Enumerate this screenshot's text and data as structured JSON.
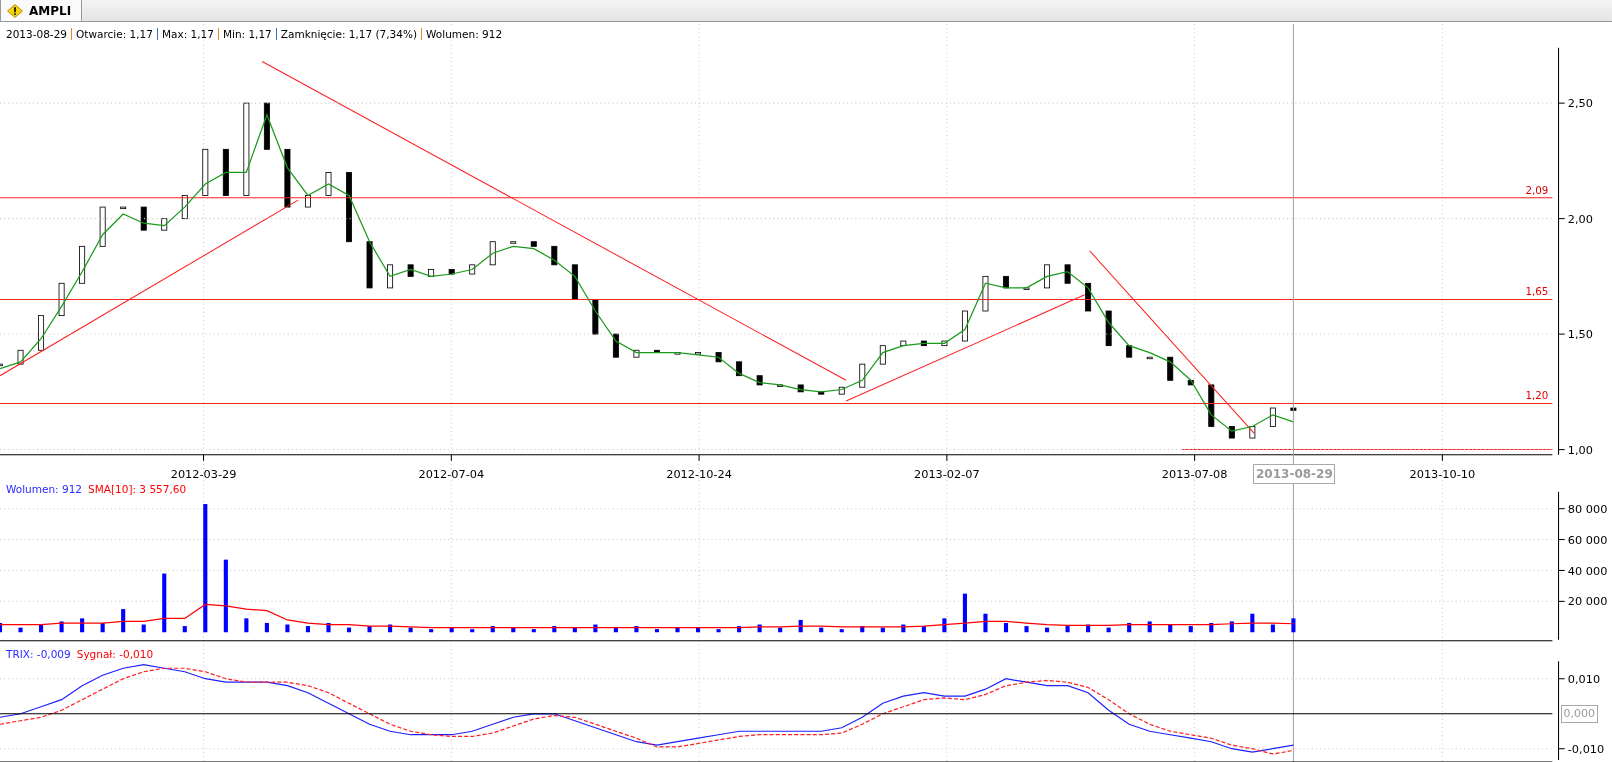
{
  "tab": {
    "label": "AMPLI",
    "selected": true
  },
  "info": [
    "2013-08-29",
    "Otwarcie: 1,17",
    "Max: 1,17",
    "Min: 1,17",
    "Zamknięcie: 1,17 (7,34%)",
    "Wolumen: 912"
  ],
  "price_panel": {
    "date_labels": [
      "2012-03-29",
      "2012-07-04",
      "2012-10-24",
      "2013-02-07",
      "2013-07-08",
      "2013-10-10"
    ],
    "cursor_label": "2013-08-29",
    "chart_data": {
      "type": "line",
      "ylim": [
        0.978,
        2.74
      ],
      "grid": true,
      "yticks": [
        {
          "value": 2.5,
          "label": "2,50"
        },
        {
          "value": 2.0,
          "label": "2,00"
        },
        {
          "value": 1.5,
          "label": "1,50"
        },
        {
          "value": 1.0,
          "label": "1,00"
        }
      ],
      "series": [
        {
          "color": "#1a9a1a",
          "values": [
            1.35,
            1.38,
            1.48,
            1.62,
            1.77,
            1.93,
            2.02,
            1.98,
            1.97,
            2.05,
            2.15,
            2.2,
            2.2,
            2.45,
            2.22,
            2.1,
            2.15,
            2.1,
            1.9,
            1.75,
            1.78,
            1.75,
            1.76,
            1.78,
            1.85,
            1.88,
            1.87,
            1.82,
            1.75,
            1.6,
            1.47,
            1.42,
            1.42,
            1.42,
            1.41,
            1.4,
            1.33,
            1.29,
            1.28,
            1.26,
            1.25,
            1.26,
            1.3,
            1.42,
            1.45,
            1.46,
            1.46,
            1.52,
            1.72,
            1.7,
            1.7,
            1.75,
            1.77,
            1.7,
            1.55,
            1.45,
            1.42,
            1.38,
            1.3,
            1.15,
            1.08,
            1.1,
            1.15,
            1.12
          ]
        }
      ],
      "ref_lines": [
        {
          "axis": "y",
          "value": 2.09,
          "label": "2,09"
        },
        {
          "axis": "y",
          "value": 1.65,
          "label": "1,65"
        },
        {
          "axis": "y",
          "value": 1.2,
          "label": "1,20"
        }
      ]
    }
  },
  "volume_panel": {
    "legend": [
      {
        "text": "Wolumen: 912",
        "color": "#2a2aff"
      },
      {
        "text": "SMA[10]: 3 557,60",
        "color": "#ff0000"
      }
    ],
    "chart_data": {
      "type": "bar",
      "ylim": [
        -4800,
        91000
      ],
      "grid": true,
      "yticks": [
        {
          "value": 80000,
          "label": "80 000"
        },
        {
          "value": 60000,
          "label": "60 000"
        },
        {
          "value": 40000,
          "label": "40 000"
        },
        {
          "value": 20000,
          "label": "20 000"
        }
      ],
      "series": [
        {
          "type": "bar",
          "color": "#0000ff",
          "values": [
            6000,
            3000,
            5000,
            7000,
            9000,
            6000,
            15000,
            5000,
            38000,
            4000,
            83000,
            47000,
            9000,
            6000,
            5000,
            4000,
            6000,
            3000,
            4000,
            5000,
            3000,
            2000,
            3000,
            2000,
            4000,
            3000,
            2000,
            4000,
            3000,
            5000,
            3000,
            4000,
            2000,
            3000,
            3000,
            2000,
            4000,
            5000,
            3000,
            8000,
            3000,
            2000,
            4000,
            3000,
            5000,
            4000,
            9000,
            25000,
            12000,
            6000,
            4000,
            3000,
            4000,
            5000,
            3000,
            6000,
            7000,
            5000,
            4000,
            6000,
            7000,
            12000,
            5000,
            9000
          ]
        },
        {
          "type": "line",
          "color": "#ff0000",
          "values": [
            5000,
            5000,
            5000,
            6000,
            6000,
            6000,
            7000,
            7000,
            9000,
            9000,
            18000,
            17000,
            15000,
            14000,
            8000,
            6000,
            5000,
            5000,
            4000,
            4000,
            3500,
            3000,
            3000,
            3000,
            3000,
            3000,
            3000,
            3000,
            3000,
            3000,
            3000,
            3000,
            3000,
            3000,
            3000,
            3000,
            3000,
            3500,
            3500,
            4000,
            4000,
            3500,
            3500,
            3500,
            3500,
            4000,
            5000,
            6000,
            7000,
            7000,
            6000,
            5000,
            4500,
            4500,
            4500,
            5000,
            5000,
            5000,
            5000,
            5000,
            5500,
            6000,
            6000,
            5500
          ]
        }
      ]
    }
  },
  "trix_panel": {
    "legend": [
      {
        "text": "TRIX: -0,009",
        "color": "#2a2aff"
      },
      {
        "text": "Sygnał: -0,010",
        "color": "#ff0000"
      }
    ],
    "zero_label": "0,000",
    "chart_data": {
      "type": "line",
      "ylim": [
        -0.0132,
        0.015
      ],
      "grid": true,
      "yticks": [
        {
          "value": 0.01,
          "label": "0,010"
        },
        {
          "value": -0.01,
          "label": "-0,010"
        }
      ],
      "series": [
        {
          "color": "#2020ff",
          "line_style": "solid",
          "values": [
            -0.001,
            0.0,
            0.002,
            0.004,
            0.008,
            0.011,
            0.013,
            0.014,
            0.013,
            0.012,
            0.01,
            0.009,
            0.009,
            0.009,
            0.008,
            0.006,
            0.003,
            0.0,
            -0.003,
            -0.005,
            -0.006,
            -0.006,
            -0.006,
            -0.005,
            -0.003,
            -0.001,
            0.0,
            0.0,
            -0.002,
            -0.004,
            -0.006,
            -0.008,
            -0.009,
            -0.008,
            -0.007,
            -0.006,
            -0.005,
            -0.005,
            -0.005,
            -0.005,
            -0.005,
            -0.004,
            -0.001,
            0.003,
            0.005,
            0.006,
            0.005,
            0.005,
            0.007,
            0.01,
            0.009,
            0.008,
            0.008,
            0.006,
            0.001,
            -0.003,
            -0.005,
            -0.006,
            -0.007,
            -0.008,
            -0.01,
            -0.011,
            -0.01,
            -0.009
          ]
        },
        {
          "color": "#ff2020",
          "line_style": "dashed",
          "values": [
            -0.003,
            -0.002,
            -0.001,
            0.001,
            0.004,
            0.007,
            0.01,
            0.012,
            0.013,
            0.013,
            0.012,
            0.01,
            0.009,
            0.009,
            0.009,
            0.008,
            0.006,
            0.003,
            0.0,
            -0.003,
            -0.005,
            -0.006,
            -0.0065,
            -0.0065,
            -0.0055,
            -0.0035,
            -0.0015,
            -0.0005,
            -0.001,
            -0.003,
            -0.005,
            -0.007,
            -0.0095,
            -0.0095,
            -0.0085,
            -0.0075,
            -0.0065,
            -0.006,
            -0.006,
            -0.006,
            -0.006,
            -0.0055,
            -0.003,
            0.0,
            0.002,
            0.004,
            0.0045,
            0.004,
            0.0055,
            0.008,
            0.009,
            0.0095,
            0.009,
            0.0075,
            0.004,
            0.0,
            -0.003,
            -0.005,
            -0.006,
            -0.007,
            -0.009,
            -0.01,
            -0.0115,
            -0.0105
          ]
        }
      ]
    }
  }
}
